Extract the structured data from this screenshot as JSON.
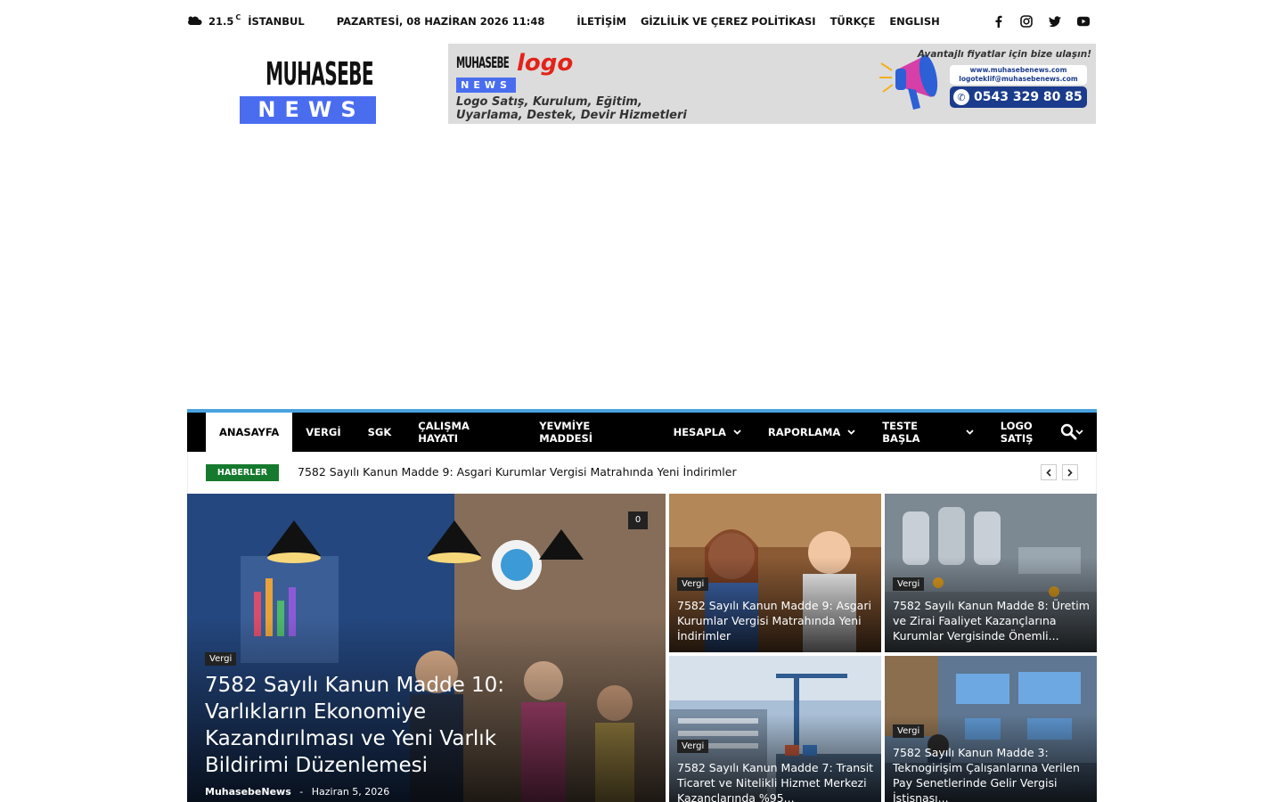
{
  "topbar": {
    "temperature": "21.5",
    "unit": "C",
    "city": "İSTANBUL",
    "date": "PAZARTESİ, 08 HAZİRAN 2026 11:48",
    "links": [
      "İLETİŞİM",
      "GİZLİLİK VE ÇEREZ POLİTİKASI",
      "TÜRKÇE",
      "ENGLISH"
    ],
    "social_icons": [
      "facebook-icon",
      "instagram-icon",
      "twitter-icon",
      "youtube-icon"
    ]
  },
  "logo": {
    "line1": "MUHASEBE",
    "line2": "NEWS"
  },
  "banner": {
    "brand_top": "MUHASEBE",
    "brand_logo": "logo",
    "brand_news": "NEWS",
    "tagline_1": "Logo Satış, Kurulum, Eğitim,",
    "tagline_2": "Uyarlama, Destek, Devir Hizmetleri",
    "advert": "Avantajlı fiyatlar için bize ulaşın!",
    "web": "www.muhasebenews.com",
    "email": "logoteklif@muhasebenews.com",
    "phone": "0543 329 80 85"
  },
  "nav": {
    "items": [
      {
        "label": "ANASAYFA",
        "dropdown": false
      },
      {
        "label": "VERGİ",
        "dropdown": false
      },
      {
        "label": "SGK",
        "dropdown": false
      },
      {
        "label": "ÇALIŞMA HAYATI",
        "dropdown": false
      },
      {
        "label": "YEVMİYE MADDESİ",
        "dropdown": false
      },
      {
        "label": "HESAPLA",
        "dropdown": true
      },
      {
        "label": "RAPORLAMA",
        "dropdown": true
      },
      {
        "label": "TESTE BAŞLA",
        "dropdown": true
      },
      {
        "label": "LOGO SATIŞ",
        "dropdown": true
      }
    ]
  },
  "ticker": {
    "badge": "HABERLER",
    "headline": "7582 Sayılı Kanun Madde 9: Asgari Kurumlar Vergisi Matrahında Yeni İndirimler"
  },
  "featured": {
    "category": "Vergi",
    "title": "7582 Sayılı Kanun Madde 10: Varlıkların Ekonomiye Kazandırılması ve Yeni Varlık Bildirimi Düzenlemesi",
    "author": "MuhasebeNews",
    "separator": "-",
    "date": "Haziran 5, 2026",
    "comments": "0"
  },
  "tiles": [
    {
      "category": "Vergi",
      "title": "7582 Sayılı Kanun Madde 9: Asgari Kurumlar Vergisi Matrahında Yeni İndirimler"
    },
    {
      "category": "Vergi",
      "title": "7582 Sayılı Kanun Madde 8: Üretim ve Zirai Faaliyet Kazançlarına Kurumlar Vergisinde Önemli..."
    },
    {
      "category": "Vergi",
      "title": "7582 Sayılı Kanun Madde 7: Transit Ticaret ve Nitelikli Hizmet Merkezi Kazançlarında %95..."
    },
    {
      "category": "Vergi",
      "title": "7582 Sayılı Kanun Madde 3: Teknogirişim Çalışanlarına Verilen Pay Senetlerinde Gelir Vergisi İstisnası..."
    }
  ]
}
